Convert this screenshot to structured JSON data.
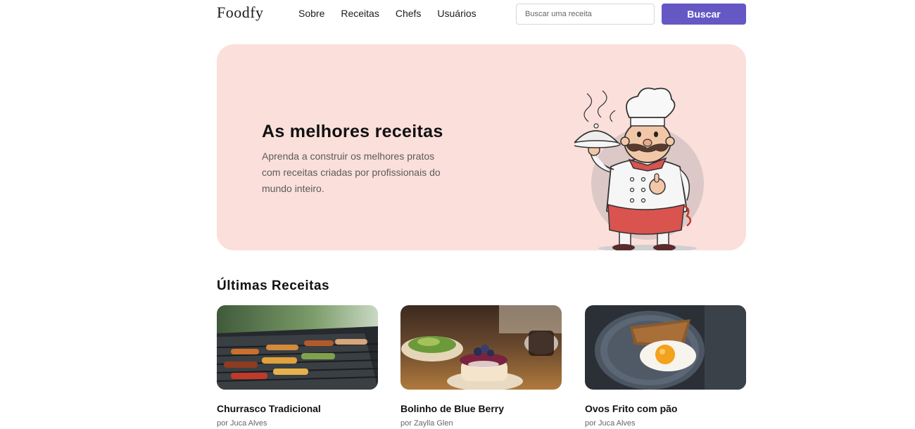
{
  "header": {
    "logo": "Foodfy",
    "nav": [
      "Sobre",
      "Receitas",
      "Chefs",
      "Usuários"
    ],
    "search_placeholder": "Buscar uma receita",
    "search_button": "Buscar"
  },
  "hero": {
    "title": "As melhores receitas",
    "description": "Aprenda a construir os melhores pratos com receitas criadas por profissionais do mundo inteiro."
  },
  "section": {
    "title": "Últimas Receitas"
  },
  "recipes": [
    {
      "title": "Churrasco Tradicional",
      "author": "por Juca Alves"
    },
    {
      "title": "Bolinho de Blue Berry",
      "author": "por Zaylla Glen"
    },
    {
      "title": "Ovos Frito com pão",
      "author": "por Juca Alves"
    }
  ],
  "colors": {
    "accent": "#6558c5",
    "hero_bg": "#fbdfdb"
  }
}
